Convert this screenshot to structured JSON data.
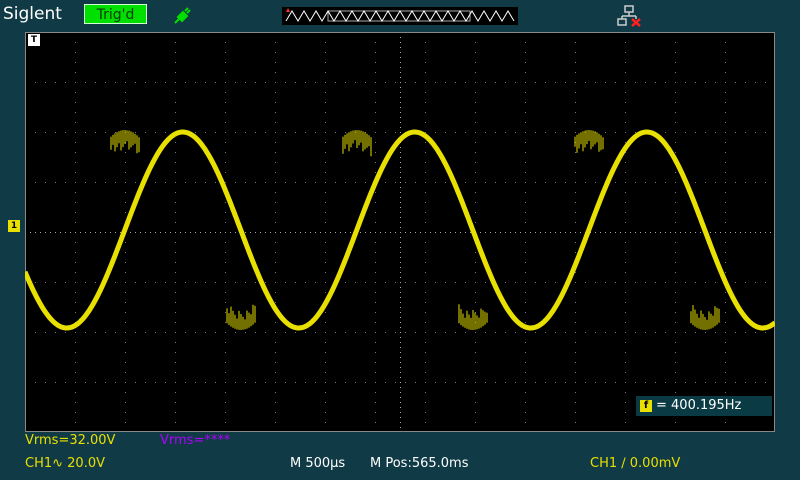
{
  "header": {
    "brand": "Siglent",
    "trigger_status": "Trig'd"
  },
  "colors": {
    "background": "#103a45",
    "trigger_green": "#00e000",
    "channel1": "#e8e000",
    "measurement_purple": "#b000ff"
  },
  "icons": {
    "probe": "usb-probe-icon",
    "network": "network-icon"
  },
  "markers": {
    "trigger_marker": "T",
    "channel1_marker": "1"
  },
  "measurement": {
    "freq_icon": "f",
    "frequency": "= 400.195Hz"
  },
  "footer": {
    "vrms_ch1": "Vrms=32.00V",
    "vrms_ch2": "Vrms=****",
    "ch1_scale": "CH1∿ 20.0V",
    "timebase": "M 500µs",
    "mpos": "M Pos:565.0ms",
    "trigger_setting": "CH1 ∕ 0.00mV"
  }
}
